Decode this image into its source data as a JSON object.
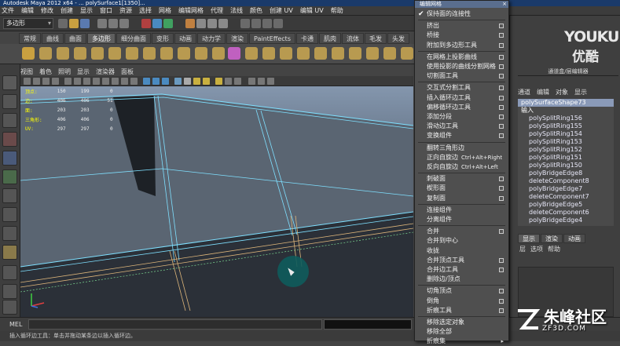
{
  "window": {
    "title": "Autodesk Maya 2012 x64 - ...  polySurface1[1350]..."
  },
  "menubar": [
    "文件",
    "编辑",
    "修改",
    "创建",
    "显示",
    "窗口",
    "资源",
    "选择",
    "网格",
    "编辑网格",
    "代理",
    "法线",
    "颜色",
    "创建 UV",
    "编辑 UV",
    "帮助"
  ],
  "status": {
    "mode": "多边形"
  },
  "shelf_tabs": [
    "常规",
    "曲线",
    "曲面",
    "多边形",
    "细分曲面",
    "变形",
    "动画",
    "动力学",
    "渲染",
    "PaintEffects",
    "卡通",
    "肌肉",
    "流体",
    "毛发",
    "头发"
  ],
  "shelf_active": "多边形",
  "viewport": {
    "menu": [
      "视图",
      "着色",
      "照明",
      "显示",
      "渲染器",
      "面板"
    ],
    "hud": {
      "rows": [
        {
          "label": "顶点:",
          "a": "150",
          "b": "199",
          "c": "0"
        },
        {
          "label": "边:",
          "a": "406",
          "b": "406",
          "c": "51"
        },
        {
          "label": "面:",
          "a": "203",
          "b": "203",
          "c": "0"
        },
        {
          "label": "三角形:",
          "a": "406",
          "b": "406",
          "c": "0"
        },
        {
          "label": "UV:",
          "a": "297",
          "b": "297",
          "c": "0"
        }
      ]
    }
  },
  "mel": {
    "label": "MEL"
  },
  "helpline": {
    "text": "插入循环边工具：单击并拖动某条边以插入循环边。"
  },
  "dropdown": {
    "title": "编辑网格",
    "close": "×",
    "items": [
      {
        "label": "保持面的连接性",
        "check": true
      },
      {
        "label": "挤出",
        "opt": true
      },
      {
        "label": "桥接",
        "opt": true
      },
      {
        "label": "附加到多边形工具",
        "opt": true
      },
      {
        "label": "在网格上投影曲线",
        "opt": true
      },
      {
        "label": "使用投影的曲线分割网格",
        "opt": true
      },
      {
        "label": "切割面工具",
        "opt": true
      },
      {
        "label": "交互式分割工具",
        "opt": true
      },
      {
        "label": "插入循环边工具",
        "opt": true
      },
      {
        "label": "偏移循环边工具",
        "opt": true
      },
      {
        "label": "添加分段",
        "opt": true
      },
      {
        "label": "滑动边工具",
        "opt": true
      },
      {
        "label": "变换组件",
        "opt": true
      },
      {
        "label": "翻转三角形边",
        "opt": false
      },
      {
        "label": "正向自旋边",
        "shortcut": "Ctrl+Alt+Right"
      },
      {
        "label": "反向自旋边",
        "shortcut": "Ctrl+Alt+Left"
      },
      {
        "label": "刺破面",
        "opt": true
      },
      {
        "label": "楔形面",
        "opt": true
      },
      {
        "label": "复制面",
        "opt": true
      },
      {
        "label": "连接组件",
        "opt": false
      },
      {
        "label": "分离组件",
        "opt": false
      },
      {
        "label": "合并",
        "opt": true
      },
      {
        "label": "合并到中心",
        "opt": false
      },
      {
        "label": "收拢",
        "opt": false
      },
      {
        "label": "合并顶点工具",
        "opt": true
      },
      {
        "label": "合并边工具",
        "opt": true
      },
      {
        "label": "删除边/顶点",
        "opt": false
      },
      {
        "label": "切角顶点",
        "opt": true
      },
      {
        "label": "倒角",
        "opt": true
      },
      {
        "label": "折痕工具",
        "opt": true
      },
      {
        "label": "移除选定对象",
        "opt": false
      },
      {
        "label": "移除全部",
        "opt": false
      },
      {
        "label": "折痕集",
        "submenu": true
      }
    ]
  },
  "channelbox": {
    "title": "通道盒/层编辑器",
    "menu": [
      "通道",
      "编辑",
      "对象",
      "显示"
    ],
    "items": [
      {
        "label": "polySurfaceShape73",
        "indent": false
      },
      {
        "label": "输入",
        "indent": false
      },
      {
        "label": "polySplitRing156",
        "indent": true
      },
      {
        "label": "polySplitRing155",
        "indent": true
      },
      {
        "label": "polySplitRing154",
        "indent": true
      },
      {
        "label": "polySplitRing153",
        "indent": true
      },
      {
        "label": "polySplitRing152",
        "indent": true
      },
      {
        "label": "polySplitRing151",
        "indent": true
      },
      {
        "label": "polySplitRing150",
        "indent": true
      },
      {
        "label": "polyBridgeEdge8",
        "indent": true
      },
      {
        "label": "deleteComponent8",
        "indent": true
      },
      {
        "label": "polyBridgeEdge7",
        "indent": true
      },
      {
        "label": "deleteComponent7",
        "indent": true
      },
      {
        "label": "polyBridgeEdge5",
        "indent": true
      },
      {
        "label": "deleteComponent6",
        "indent": true
      },
      {
        "label": "polyBridgeEdge4",
        "indent": true
      }
    ]
  },
  "layers": {
    "tabs": [
      "显示",
      "渲染",
      "动画"
    ],
    "menu": [
      "层",
      "选项",
      "帮助"
    ]
  },
  "watermarks": {
    "youku": "YOUKU",
    "youku_cn": "优酷",
    "site": "朱峰社区",
    "site_url": "ZF3D.COM"
  },
  "colors": {
    "accent": "#5a6e8e",
    "wire": "#7fe0ff",
    "viewport_top": "#8496ad",
    "viewport_bottom": "#262e38"
  }
}
